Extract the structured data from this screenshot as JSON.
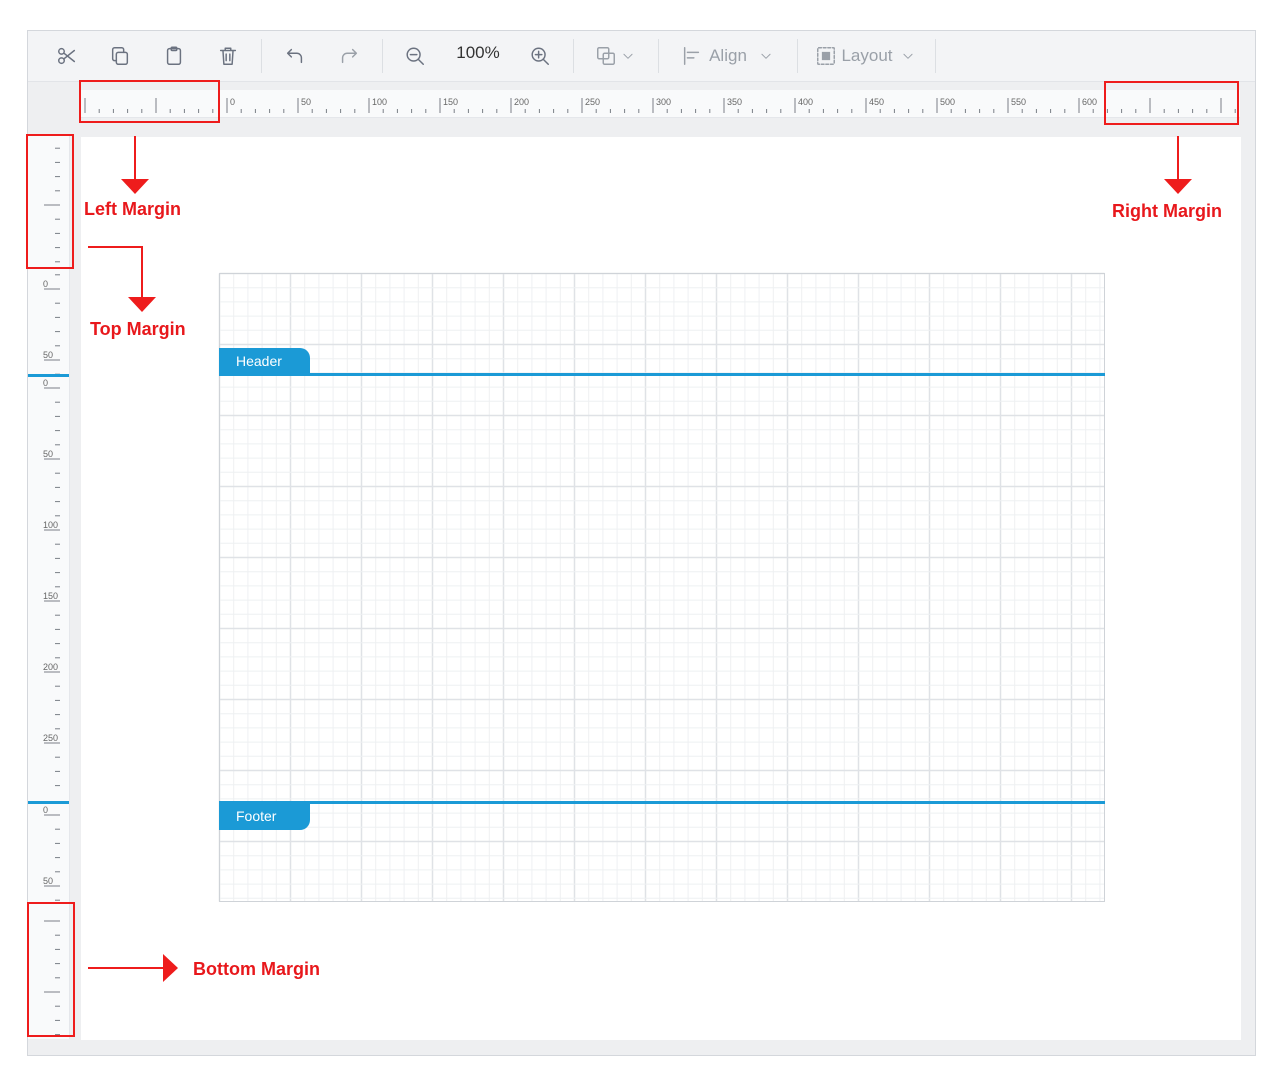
{
  "toolbar": {
    "zoom": "100%",
    "align_label": "Align",
    "layout_label": "Layout",
    "icons": [
      "scissors-icon",
      "copy-icon",
      "paste-icon",
      "delete-icon",
      "undo-icon",
      "redo-icon",
      "zoom-out-icon",
      "zoom-in-icon",
      "order-icon",
      "chevron-down-icon",
      "align-icon",
      "layout-icon"
    ]
  },
  "ruler": {
    "horizontal_labels": [
      "0",
      "50",
      "100",
      "150",
      "200",
      "250",
      "300",
      "350",
      "400",
      "450",
      "500",
      "550",
      "600"
    ],
    "vertical_header": [
      "0",
      "50"
    ],
    "vertical_body": [
      "0",
      "50",
      "100",
      "150",
      "200",
      "250"
    ],
    "vertical_footer": [
      "0",
      "50"
    ]
  },
  "report": {
    "header_label": "Header",
    "footer_label": "Footer"
  },
  "annotations": {
    "left_margin": "Left Margin",
    "top_margin": "Top Margin",
    "right_margin": "Right Margin",
    "bottom_margin": "Bottom Margin"
  },
  "colors": {
    "accent": "#1b9ad6",
    "annotation": "#e8181c",
    "grid_minor": "#eef0f2",
    "grid_major": "#dfe2e6"
  }
}
